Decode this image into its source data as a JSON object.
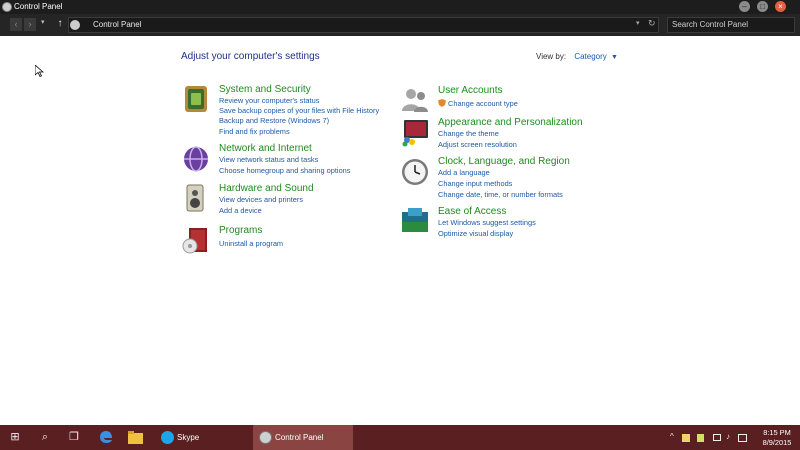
{
  "window": {
    "title": "Control Panel",
    "minimize": "–",
    "maximize": "□",
    "close": "×"
  },
  "addressbar": {
    "back": "‹",
    "forward": "›",
    "recent": "▾",
    "up": "↑",
    "breadcrumb": "Control Panel",
    "dropdown": "▾",
    "refresh": "↻",
    "search_placeholder": "Search Control Panel"
  },
  "content": {
    "heading": "Adjust your computer's settings",
    "view_by_label": "View by:",
    "view_by_value": "Category",
    "view_by_caret": "▼"
  },
  "categories": [
    {
      "title": "System and Security",
      "links": [
        "Review your computer's status",
        "Save backup copies of your files with File History",
        "Backup and Restore (Windows 7)",
        "Find and fix problems"
      ]
    },
    {
      "title": "Network and Internet",
      "links": [
        "View network status and tasks",
        "Choose homegroup and sharing options"
      ]
    },
    {
      "title": "Hardware and Sound",
      "links": [
        "View devices and printers",
        "Add a device"
      ]
    },
    {
      "title": "Programs",
      "links": [
        "Uninstall a program"
      ]
    },
    {
      "title": "User Accounts",
      "links": [
        "Change account type"
      ]
    },
    {
      "title": "Appearance and Personalization",
      "links": [
        "Change the theme",
        "Adjust screen resolution"
      ]
    },
    {
      "title": "Clock, Language, and Region",
      "links": [
        "Add a language",
        "Change input methods",
        "Change date, time, or number formats"
      ]
    },
    {
      "title": "Ease of Access",
      "links": [
        "Let Windows suggest settings",
        "Optimize visual display"
      ]
    }
  ],
  "taskbar": {
    "start": "⊞",
    "search": "⌕",
    "taskview": "❐",
    "apps": [
      {
        "label": "Skype"
      },
      {
        "label": "Control Panel"
      }
    ],
    "clock_time": "8:15 PM",
    "clock_date": "8/9/2015",
    "tray_chevron": "^",
    "tray_volume": "♪",
    "tray_lang": "ENG"
  }
}
